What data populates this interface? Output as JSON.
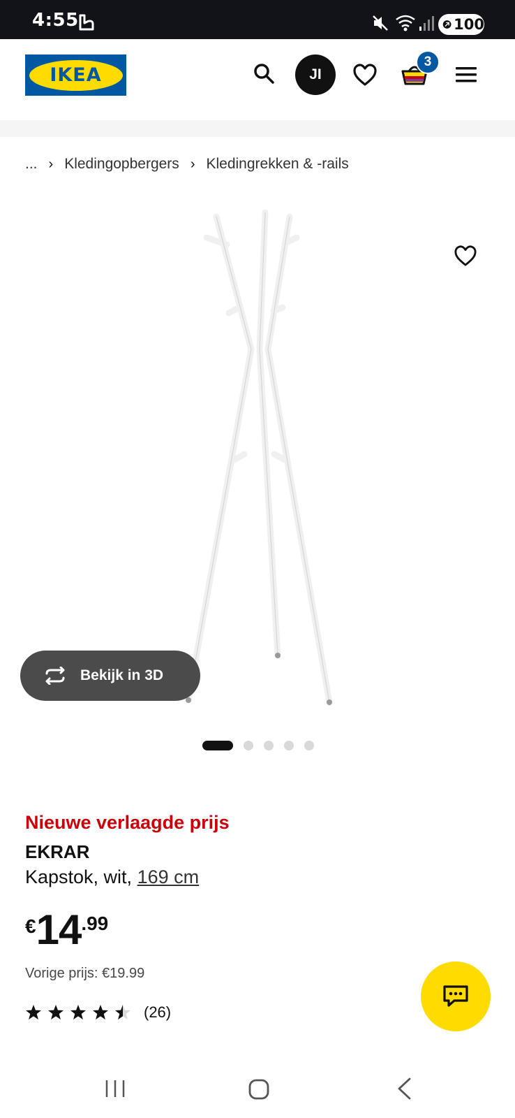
{
  "status_bar": {
    "time": "4:55",
    "battery": "100",
    "icons": [
      "app-notification-icon",
      "mute-icon",
      "wifi-icon",
      "signal-icon",
      "battery-icon"
    ]
  },
  "header": {
    "logo_text": "IKEA",
    "avatar_initials": "JI",
    "basket_count": "3",
    "icons": [
      "search-icon",
      "heart-icon",
      "basket-icon",
      "menu-icon"
    ]
  },
  "breadcrumb": {
    "ellipsis": "...",
    "items": [
      "Kledingopbergers",
      "Kledingrekken & -rails"
    ],
    "separator": "›"
  },
  "gallery": {
    "view_3d_label": "Bekijk in 3D",
    "image_count": 5,
    "active_index": 0
  },
  "product": {
    "price_tag": "Nieuwe verlaagde prijs",
    "name": "EKRAR",
    "description": "Kapstok, wit, ",
    "size": "169 cm",
    "currency": "€",
    "price_integer": "14",
    "price_decimal": ".99",
    "previous_price": "Vorige prijs: €19.99",
    "rating_value": 4.5,
    "rating_max": 5,
    "review_count": "(26)"
  },
  "colors": {
    "ikea_blue": "#0058a3",
    "ikea_yellow": "#ffdb00",
    "sale_red": "#cc0008",
    "dark_button": "#4b4b4b"
  }
}
